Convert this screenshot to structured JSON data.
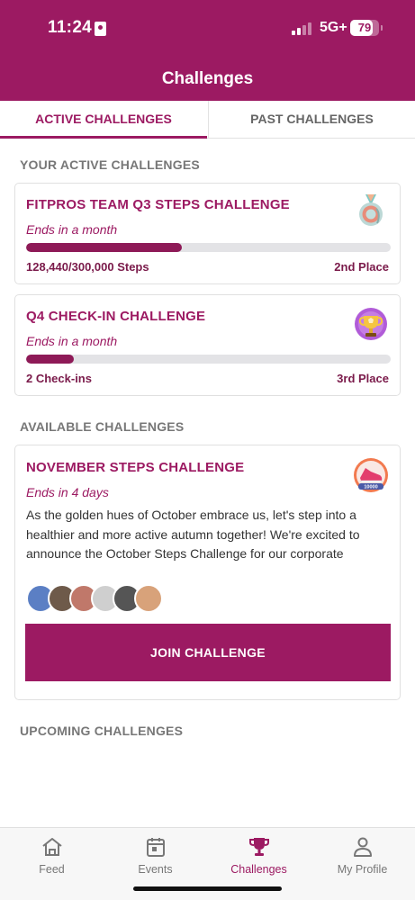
{
  "status_bar": {
    "time": "11:24",
    "network": "5G+",
    "battery": "79",
    "battery_level": 0.79
  },
  "header": {
    "title": "Challenges"
  },
  "tabs": [
    {
      "label": "ACTIVE CHALLENGES",
      "active": true
    },
    {
      "label": "PAST CHALLENGES",
      "active": false
    }
  ],
  "sections": {
    "active": "YOUR ACTIVE CHALLENGES",
    "available": "AVAILABLE CHALLENGES",
    "upcoming": "UPCOMING CHALLENGES"
  },
  "active_challenges": [
    {
      "title": "FITPROS TEAM Q3 STEPS CHALLENGE",
      "ends": "Ends in a month",
      "progress": 0.428,
      "stat": "128,440/300,000 Steps",
      "place": "2nd Place",
      "badge": "medal-icon"
    },
    {
      "title": "Q4 CHECK-IN CHALLENGE",
      "ends": "Ends in a month",
      "progress": 0.13,
      "stat": "2 Check-ins",
      "place": "3rd Place",
      "badge": "trophy-badge-icon"
    }
  ],
  "available_challenges": [
    {
      "title": "NOVEMBER STEPS CHALLENGE",
      "ends": "Ends in 4 days",
      "description": "As the golden hues of October embrace us, let's step into a healthier and more active autumn together! We're excited to announce the October Steps Challenge for our corporate",
      "badge": "sneaker-badge-icon",
      "badge_text": "10000",
      "participant_count": 6,
      "button": "JOIN CHALLENGE"
    }
  ],
  "colors": {
    "brand": "#9c1a62",
    "progress_track": "#e3e3e6"
  },
  "nav": [
    {
      "label": "Feed",
      "icon": "home-icon",
      "active": false
    },
    {
      "label": "Events",
      "icon": "calendar-icon",
      "active": false
    },
    {
      "label": "Challenges",
      "icon": "trophy-icon",
      "active": true
    },
    {
      "label": "My Profile",
      "icon": "person-icon",
      "active": false
    }
  ]
}
